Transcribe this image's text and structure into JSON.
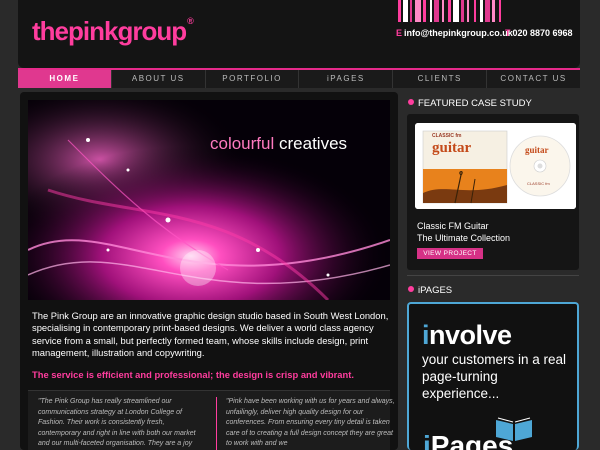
{
  "header": {
    "logo": "thepinkgroup",
    "logo_mark": "®",
    "email_label": "E",
    "email": "info@thepinkgroup.co.uk",
    "phone_label": "T",
    "phone": "020 8870 6968"
  },
  "nav": {
    "items": [
      {
        "label": "HOME",
        "active": true
      },
      {
        "label": "ABOUT US",
        "active": false
      },
      {
        "label": "PORTFOLIO",
        "active": false
      },
      {
        "label": "iPAGES",
        "active": false
      },
      {
        "label": "CLIENTS",
        "active": false
      },
      {
        "label": "CONTACT US",
        "active": false
      }
    ]
  },
  "hero": {
    "title_pink": "colourful",
    "title_white": "creatives"
  },
  "main": {
    "intro": "The Pink Group are an innovative graphic design studio based in South West London, specialising in contemporary print-based designs. We deliver a world class agency service from a small, but perfectly formed team, whose skills include design, print management, illustration and copywriting.",
    "tagline": "The service is efficient and professional; the design is crisp and vibrant.",
    "quote_left": "\"The Pink Group has really streamlined our communications strategy at London College of Fashion. Their work is consistently fresh, contemporary and right in line with both our market and our multi-faceted organisation. They are a joy",
    "quote_right": "\"Pink have been working with us for years and always, unfailingly, deliver high quality design for our conferences. From ensuring every tiny detail is taken care of to creating a full design concept they are great to work with and we"
  },
  "sidebar": {
    "featured_heading": "FEATURED CASE STUDY",
    "case_title_1": "Classic FM Guitar",
    "case_title_2": "The Ultimate Collection",
    "view_button": "VIEW PROJECT",
    "product_label_top": "CLASSIC",
    "product_label_fm": "fm",
    "product_label_main": "guitar",
    "ipages_heading": "iPAGES",
    "involve_i": "i",
    "involve_rest": "nvolve",
    "involve_sub": "your customers in a real page-turning experience...",
    "ipages_i": "i",
    "ipages_rest": "Pages"
  },
  "colors": {
    "accent": "#ff3d9e",
    "nav_active": "#e0388f",
    "ipages_blue": "#4ea7d6"
  }
}
